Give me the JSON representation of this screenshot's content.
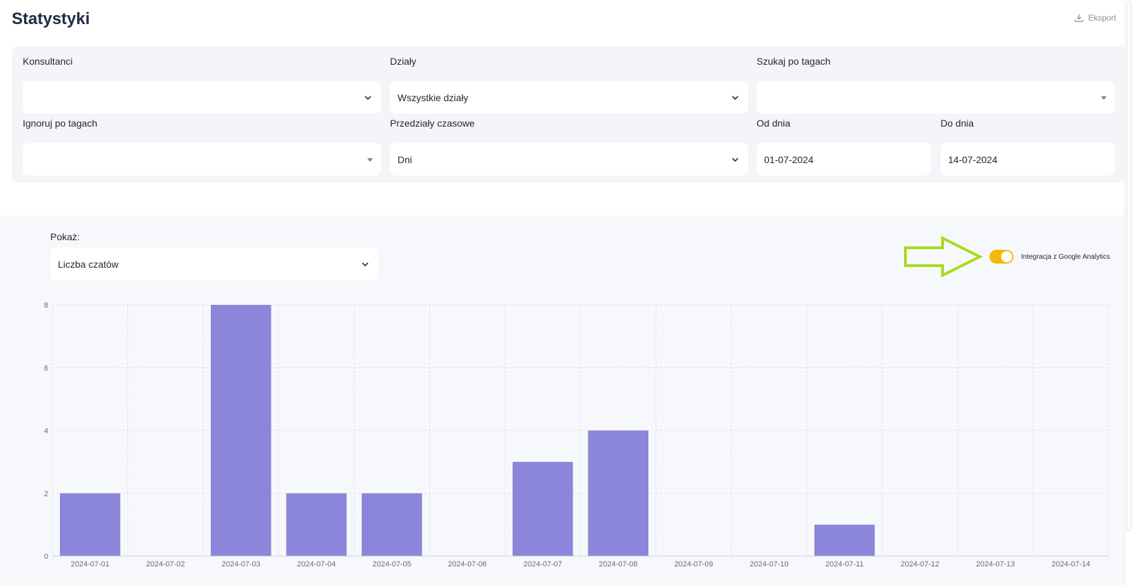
{
  "header": {
    "title": "Statystyki",
    "export_label": "Eksport"
  },
  "filters": {
    "consultants": {
      "label": "Konsultanci",
      "value": ""
    },
    "departments": {
      "label": "Działy",
      "value": "Wszystkie działy"
    },
    "search_tags": {
      "label": "Szukaj po tagach",
      "value": ""
    },
    "ignore_tags": {
      "label": "Ignoruj po tagach",
      "value": ""
    },
    "time_ranges": {
      "label": "Przedziały czasowe",
      "value": "Dni"
    },
    "from_date": {
      "label": "Od dnia",
      "value": "01-07-2024"
    },
    "to_date": {
      "label": "Do dnia",
      "value": "14-07-2024"
    }
  },
  "show": {
    "label": "Pokaż:",
    "value": "Liczba czatów"
  },
  "ga_toggle": {
    "label": "Integracja z Google Analytics",
    "on": true,
    "color": "#f6b90b"
  },
  "annotation": {
    "color": "#a4dd1c"
  },
  "chart_data": {
    "type": "bar",
    "categories": [
      "2024-07-01",
      "2024-07-02",
      "2024-07-03",
      "2024-07-04",
      "2024-07-05",
      "2024-07-06",
      "2024-07-07",
      "2024-07-08",
      "2024-07-09",
      "2024-07-10",
      "2024-07-11",
      "2024-07-12",
      "2024-07-13",
      "2024-07-14"
    ],
    "values": [
      2,
      0,
      8,
      2,
      2,
      0,
      3,
      4,
      0,
      0,
      1,
      0,
      0,
      0
    ],
    "ylim": [
      0,
      8
    ],
    "yticks": [
      0,
      2,
      4,
      6,
      8
    ],
    "grid": true,
    "bar_color": "#8b86d9"
  }
}
